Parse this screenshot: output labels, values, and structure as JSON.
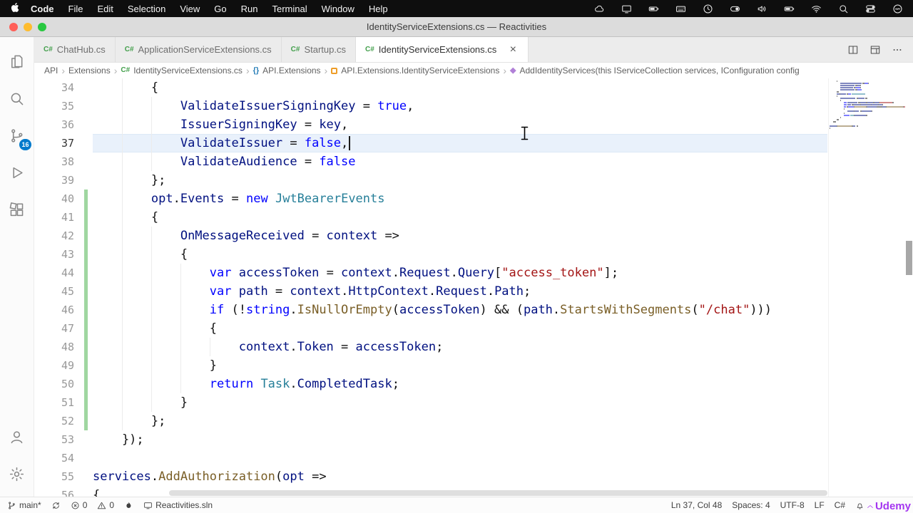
{
  "menubar": {
    "apple_icon": "apple-icon",
    "items": [
      "Code",
      "File",
      "Edit",
      "Selection",
      "View",
      "Go",
      "Run",
      "Terminal",
      "Window",
      "Help"
    ],
    "status_icons": [
      "cloud-icon",
      "display-icon",
      "battery-icon",
      "keyboard-icon",
      "clock-icon",
      "toggle-icon",
      "volume-icon",
      "battery-icon",
      "wifi-icon",
      "spotlight-search-icon",
      "control-center-icon",
      "siri-icon"
    ]
  },
  "titlebar": {
    "title": "IdentityServiceExtensions.cs — Reactivities"
  },
  "tabbar": {
    "tabs": [
      {
        "label": "ChatHub.cs",
        "active": false
      },
      {
        "label": "ApplicationServiceExtensions.cs",
        "active": false
      },
      {
        "label": "Startup.cs",
        "active": false
      },
      {
        "label": "IdentityServiceExtensions.cs",
        "active": true
      }
    ],
    "actions": [
      "split-editor-icon",
      "layout-icon",
      "more-actions-icon"
    ]
  },
  "breadcrumbs": [
    {
      "label": "API"
    },
    {
      "label": "Extensions"
    },
    {
      "label": "IdentityServiceExtensions.cs",
      "icon": "csharp-file-icon"
    },
    {
      "label": "API.Extensions",
      "icon": "namespace-icon"
    },
    {
      "label": "API.Extensions.IdentityServiceExtensions",
      "icon": "class-icon"
    },
    {
      "label": "AddIdentityServices(this IServiceCollection services, IConfiguration config",
      "icon": "method-icon"
    }
  ],
  "activity_bar": {
    "top": [
      {
        "icon": "files-icon"
      },
      {
        "icon": "search-icon"
      },
      {
        "icon": "source-control-icon",
        "badge": "16"
      },
      {
        "icon": "run-debug-icon"
      },
      {
        "icon": "extensions-icon"
      }
    ],
    "bottom": [
      {
        "icon": "account-icon"
      },
      {
        "icon": "settings-gear-icon"
      }
    ]
  },
  "editor": {
    "active_line": 37,
    "token_colors": {
      "kw": "#0000ff",
      "type": "#267f99",
      "var": "#001080",
      "method": "#795e26",
      "str": "#a31515",
      "pun": "#111111",
      "ws": "#111111"
    },
    "lines": [
      {
        "n": 34,
        "t": [
          [
            "        {",
            "pun"
          ]
        ]
      },
      {
        "n": 35,
        "t": [
          [
            "            ",
            "ws"
          ],
          [
            "ValidateIssuerSigningKey",
            "var"
          ],
          [
            " = ",
            "pun"
          ],
          [
            "true",
            "kw"
          ],
          [
            ",",
            "pun"
          ]
        ]
      },
      {
        "n": 36,
        "t": [
          [
            "            ",
            "ws"
          ],
          [
            "IssuerSigningKey",
            "var"
          ],
          [
            " = ",
            "pun"
          ],
          [
            "key",
            "var"
          ],
          [
            ",",
            "pun"
          ]
        ]
      },
      {
        "n": 37,
        "cursor": true,
        "t": [
          [
            "            ",
            "ws"
          ],
          [
            "ValidateIssuer",
            "var"
          ],
          [
            " = ",
            "pun"
          ],
          [
            "false",
            "kw"
          ],
          [
            ",",
            "pun"
          ]
        ]
      },
      {
        "n": 38,
        "t": [
          [
            "            ",
            "ws"
          ],
          [
            "ValidateAudience",
            "var"
          ],
          [
            " = ",
            "pun"
          ],
          [
            "false",
            "kw"
          ]
        ]
      },
      {
        "n": 39,
        "t": [
          [
            "        };",
            "pun"
          ]
        ]
      },
      {
        "n": 40,
        "t": [
          [
            "        ",
            "ws"
          ],
          [
            "opt",
            "var"
          ],
          [
            ".",
            "pun"
          ],
          [
            "Events",
            "var"
          ],
          [
            " = ",
            "pun"
          ],
          [
            "new",
            "kw"
          ],
          [
            " ",
            "ws"
          ],
          [
            "JwtBearerEvents",
            "type"
          ]
        ]
      },
      {
        "n": 41,
        "t": [
          [
            "        {",
            "pun"
          ]
        ]
      },
      {
        "n": 42,
        "t": [
          [
            "            ",
            "ws"
          ],
          [
            "OnMessageReceived",
            "var"
          ],
          [
            " = ",
            "pun"
          ],
          [
            "context",
            "var"
          ],
          [
            " =>",
            "pun"
          ]
        ]
      },
      {
        "n": 43,
        "t": [
          [
            "            {",
            "pun"
          ]
        ]
      },
      {
        "n": 44,
        "t": [
          [
            "                ",
            "ws"
          ],
          [
            "var",
            "kw"
          ],
          [
            " ",
            "ws"
          ],
          [
            "accessToken",
            "var"
          ],
          [
            " = ",
            "pun"
          ],
          [
            "context",
            "var"
          ],
          [
            ".",
            "pun"
          ],
          [
            "Request",
            "var"
          ],
          [
            ".",
            "pun"
          ],
          [
            "Query",
            "var"
          ],
          [
            "[",
            "pun"
          ],
          [
            "\"access_token\"",
            "str"
          ],
          [
            "];",
            "pun"
          ]
        ]
      },
      {
        "n": 45,
        "t": [
          [
            "                ",
            "ws"
          ],
          [
            "var",
            "kw"
          ],
          [
            " ",
            "ws"
          ],
          [
            "path",
            "var"
          ],
          [
            " = ",
            "pun"
          ],
          [
            "context",
            "var"
          ],
          [
            ".",
            "pun"
          ],
          [
            "HttpContext",
            "var"
          ],
          [
            ".",
            "pun"
          ],
          [
            "Request",
            "var"
          ],
          [
            ".",
            "pun"
          ],
          [
            "Path",
            "var"
          ],
          [
            ";",
            "pun"
          ]
        ]
      },
      {
        "n": 46,
        "t": [
          [
            "                ",
            "ws"
          ],
          [
            "if",
            "kw"
          ],
          [
            " (!",
            "pun"
          ],
          [
            "string",
            "kw"
          ],
          [
            ".",
            "pun"
          ],
          [
            "IsNullOrEmpty",
            "method"
          ],
          [
            "(",
            "pun"
          ],
          [
            "accessToken",
            "var"
          ],
          [
            ") && (",
            "pun"
          ],
          [
            "path",
            "var"
          ],
          [
            ".",
            "pun"
          ],
          [
            "StartsWithSegments",
            "method"
          ],
          [
            "(",
            "pun"
          ],
          [
            "\"/chat\"",
            "str"
          ],
          [
            ")))",
            "pun"
          ]
        ]
      },
      {
        "n": 47,
        "t": [
          [
            "                {",
            "pun"
          ]
        ]
      },
      {
        "n": 48,
        "t": [
          [
            "                    ",
            "ws"
          ],
          [
            "context",
            "var"
          ],
          [
            ".",
            "pun"
          ],
          [
            "Token",
            "var"
          ],
          [
            " = ",
            "pun"
          ],
          [
            "accessToken",
            "var"
          ],
          [
            ";",
            "pun"
          ]
        ]
      },
      {
        "n": 49,
        "t": [
          [
            "                }",
            "pun"
          ]
        ]
      },
      {
        "n": 50,
        "t": [
          [
            "                ",
            "ws"
          ],
          [
            "return",
            "kw"
          ],
          [
            " ",
            "ws"
          ],
          [
            "Task",
            "type"
          ],
          [
            ".",
            "pun"
          ],
          [
            "CompletedTask",
            "var"
          ],
          [
            ";",
            "pun"
          ]
        ]
      },
      {
        "n": 51,
        "t": [
          [
            "            }",
            "pun"
          ]
        ]
      },
      {
        "n": 52,
        "t": [
          [
            "        };",
            "pun"
          ]
        ]
      },
      {
        "n": 53,
        "t": [
          [
            "    });",
            "pun"
          ]
        ]
      },
      {
        "n": 54,
        "t": [
          [
            "",
            "ws"
          ]
        ]
      },
      {
        "n": 55,
        "t": [
          [
            "services",
            "var"
          ],
          [
            ".",
            "pun"
          ],
          [
            "AddAuthorization",
            "method"
          ],
          [
            "(",
            "pun"
          ],
          [
            "opt",
            "var"
          ],
          [
            " =>",
            "pun"
          ]
        ]
      },
      {
        "n": 56,
        "t": [
          [
            "{",
            "pun"
          ]
        ]
      }
    ]
  },
  "status_bar": {
    "left": [
      {
        "name": "git-branch",
        "icon": "git-branch-icon",
        "label": "main*"
      },
      {
        "name": "sync",
        "icon": "sync-icon",
        "label": ""
      },
      {
        "name": "errors",
        "icon": "error-icon",
        "label": "0"
      },
      {
        "name": "warnings",
        "icon": "warning-icon",
        "label": "0"
      },
      {
        "name": "omnisharp-flame",
        "icon": "flame-icon",
        "label": ""
      },
      {
        "name": "solution",
        "icon": "monitor-icon",
        "label": "Reactivities.sln"
      }
    ],
    "right": [
      {
        "name": "cursor-position",
        "label": "Ln 37, Col 48"
      },
      {
        "name": "indentation",
        "label": "Spaces: 4"
      },
      {
        "name": "encoding",
        "label": "UTF-8"
      },
      {
        "name": "eol",
        "label": "LF"
      },
      {
        "name": "language-mode",
        "label": "C#"
      },
      {
        "name": "notifications",
        "icon": "bell-icon",
        "label": ""
      }
    ]
  },
  "watermark": "Udemy"
}
